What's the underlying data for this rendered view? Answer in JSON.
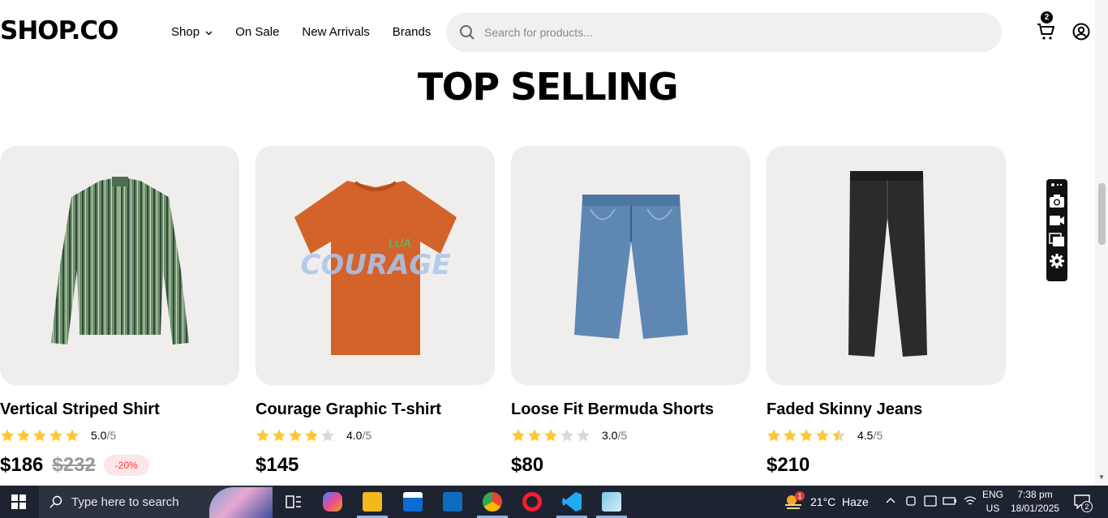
{
  "header": {
    "logo": "SHOP.CO",
    "nav": [
      "Shop",
      "On Sale",
      "New Arrivals",
      "Brands"
    ],
    "search_placeholder": "Search for products...",
    "cart_count": "2"
  },
  "section": {
    "title": "TOP SELLING"
  },
  "products": [
    {
      "name": "Vertical Striped Shirt",
      "rating": "5.0",
      "rating_max": "/5",
      "rating_value": 5.0,
      "price": "$186",
      "old_price": "$232",
      "discount": "-20%"
    },
    {
      "name": "Courage Graphic T-shirt",
      "rating": "4.0",
      "rating_max": "/5",
      "rating_value": 4.0,
      "price": "$145"
    },
    {
      "name": "Loose Fit Bermuda Shorts",
      "rating": "3.0",
      "rating_max": "/5",
      "rating_value": 3.0,
      "price": "$80"
    },
    {
      "name": "Faded Skinny Jeans",
      "rating": "4.5",
      "rating_max": "/5",
      "rating_value": 4.5,
      "price": "$210"
    }
  ],
  "colors": {
    "star": "#ffc633",
    "star_empty": "#d9d9d9",
    "discount_text": "#ff3333",
    "discount_bg": "#fde6e6",
    "card_bg": "#f0eeed"
  },
  "taskbar": {
    "search_placeholder": "Type here to search",
    "weather": "21°C  Haze",
    "weather_badge": "1",
    "lang_top": "ENG",
    "lang_bottom": "US",
    "time": "7:38 pm",
    "date": "18/01/2025",
    "notifications": "2"
  }
}
